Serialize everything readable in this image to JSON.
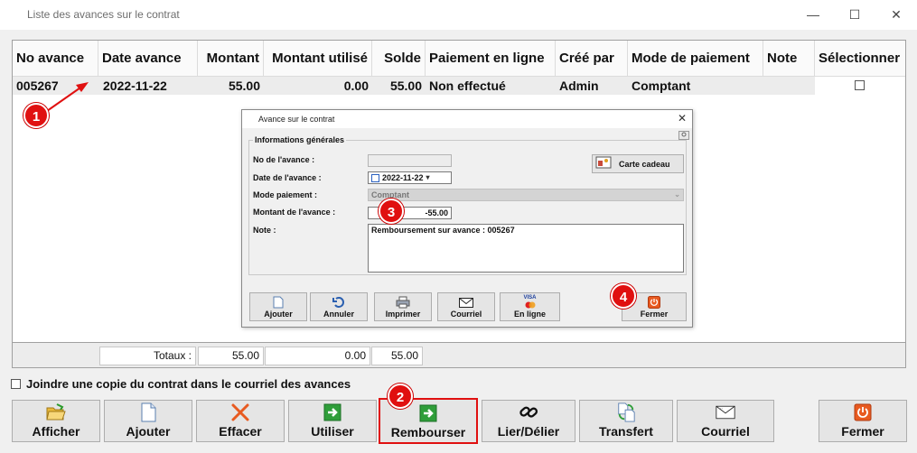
{
  "window": {
    "title": "Liste des avances sur le contrat",
    "minimize": "—",
    "maximize": "☐",
    "close": "✕"
  },
  "grid": {
    "columns": [
      "No avance",
      "Date avance",
      "Montant",
      "Montant utilisé",
      "Solde",
      "Paiement en ligne",
      "Créé par",
      "Mode de paiement",
      "Note",
      "Sélectionner"
    ],
    "rows": [
      {
        "no": "005267",
        "date": "2022-11-22",
        "montant": "55.00",
        "utilise": "0.00",
        "solde": "55.00",
        "paiement": "Non effectué",
        "cree_par": "Admin",
        "mode": "Comptant",
        "note": "",
        "selected": false
      }
    ]
  },
  "totals": {
    "label": "Totaux :",
    "montant": "55.00",
    "utilise": "0.00",
    "solde": "55.00"
  },
  "joindre_label": "Joindre une copie du contrat dans le courriel des avances",
  "buttons": {
    "afficher": "Afficher",
    "ajouter": "Ajouter",
    "effacer": "Effacer",
    "utiliser": "Utiliser",
    "rembourser": "Rembourser",
    "lier": "Lier/Délier",
    "transfert": "Transfert",
    "courriel": "Courriel",
    "fermer": "Fermer"
  },
  "badges": [
    "1",
    "2",
    "3",
    "4"
  ],
  "dialog": {
    "title": "Avance sur le contrat",
    "close": "✕",
    "group_title": "Informations générales",
    "no_label": "No de l'avance :",
    "no_value": "",
    "date_label": "Date de l'avance :",
    "date_value": "2022-11-22",
    "mode_label": "Mode paiement :",
    "mode_value": "Comptant",
    "montant_label": "Montant de l'avance :",
    "montant_value": "-55.00",
    "note_label": "Note :",
    "note_value": "Remboursement sur avance : 005267",
    "carte_cadeau": "Carte cadeau",
    "buttons": {
      "ajouter": "Ajouter",
      "annuler": "Annuler",
      "imprimer": "Imprimer",
      "courriel": "Courriel",
      "en_ligne": "En ligne",
      "fermer": "Fermer"
    },
    "visa_text": "VISA"
  },
  "colors": {
    "badge": "#e01010",
    "highlight": "#e01010",
    "arrow": "#e01010"
  }
}
